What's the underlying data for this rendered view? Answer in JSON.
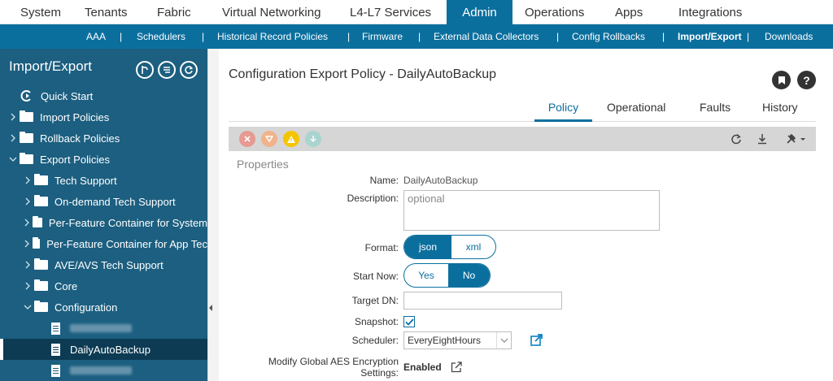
{
  "topnav": {
    "items": [
      "System",
      "Tenants",
      "Fabric",
      "Virtual Networking",
      "L4-L7 Services",
      "Admin",
      "Operations",
      "Apps",
      "Integrations"
    ],
    "active": "Admin"
  },
  "subnav": {
    "items": [
      "AAA",
      "Schedulers",
      "Historical Record Policies",
      "Firmware",
      "External Data Collectors",
      "Config Rollbacks",
      "Import/Export",
      "Downloads"
    ],
    "separator": "|",
    "active": "Import/Export"
  },
  "sidebar": {
    "title": "Import/Export",
    "actions": [
      "import-action-icon",
      "list-action-icon",
      "refresh-icon"
    ],
    "tree": [
      {
        "label": "Quick Start",
        "icon": "quick-start-icon"
      },
      {
        "label": "Import Policies",
        "icon": "folder-icon"
      },
      {
        "label": "Rollback Policies",
        "icon": "folder-icon"
      },
      {
        "label": "Export Policies",
        "icon": "folder-icon"
      },
      {
        "label": "Tech Support",
        "icon": "folder-icon"
      },
      {
        "label": "On-demand Tech Support",
        "icon": "folder-icon"
      },
      {
        "label": "Per-Feature Container for System",
        "icon": "folder-icon"
      },
      {
        "label": "Per-Feature Container for App Tec",
        "icon": "folder-icon"
      },
      {
        "label": "AVE/AVS Tech Support",
        "icon": "folder-icon"
      },
      {
        "label": "Core",
        "icon": "folder-icon"
      },
      {
        "label": "Configuration",
        "icon": "folder-icon"
      },
      {
        "label": "",
        "icon": "document-icon",
        "redacted": true
      },
      {
        "label": "DailyAutoBackup",
        "icon": "document-icon",
        "selected": true
      },
      {
        "label": "",
        "icon": "document-icon",
        "redacted": true
      }
    ]
  },
  "main": {
    "title": "Configuration Export Policy - DailyAutoBackup",
    "help": "?",
    "tabs": [
      "Policy",
      "Operational",
      "Faults",
      "History"
    ],
    "active_tab": "Policy",
    "section": "Properties",
    "fields": {
      "name_label": "Name:",
      "name_value": "DailyAutoBackup",
      "description_label": "Description:",
      "description_placeholder": "optional",
      "format_label": "Format:",
      "format_options": [
        "json",
        "xml"
      ],
      "format_selected": "json",
      "start_now_label": "Start Now:",
      "start_now_options": [
        "Yes",
        "No"
      ],
      "start_now_selected": "No",
      "target_dn_label": "Target DN:",
      "target_dn_value": "",
      "snapshot_label": "Snapshot:",
      "snapshot_checked": true,
      "scheduler_label": "Scheduler:",
      "scheduler_value": "EveryEightHours",
      "aes_label_line1": "Modify Global AES Encryption",
      "aes_label_line2": "Settings:",
      "aes_value": "Enabled"
    }
  },
  "colors": {
    "accent": "#0b6f9e",
    "sidebar": "#1c5f80",
    "sidebar_selected": "#0d3b54",
    "fault_critical": "#e69a91",
    "fault_major": "#f0b38c",
    "fault_minor": "#f5c400",
    "fault_warning": "#a9d4cf"
  }
}
